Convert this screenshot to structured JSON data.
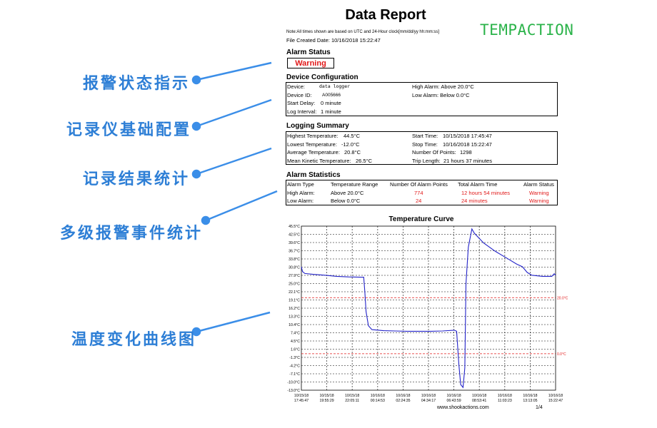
{
  "report": {
    "title": "Data Report",
    "brand": "TEMPACTION",
    "note": "Note:All times shown are based on UTC and 24-Hour clock[mm/dd/yy  hh:mm:ss]",
    "file_created": "File Created Date:  10/16/2018  15:22:47"
  },
  "alarm_status": {
    "heading": "Alarm Status",
    "value": "Warning"
  },
  "device_config": {
    "heading": "Device Configuration",
    "rows": [
      [
        "Device:",
        "data logger",
        "High Alarm: Above 20.0°C"
      ],
      [
        "Device ID:",
        "A005666",
        "Low Alarm:  Below 0.0°C"
      ],
      [
        "Start Delay:",
        "0 minute",
        ""
      ],
      [
        "Log Interval:",
        "1 minute",
        ""
      ]
    ]
  },
  "logging_summary": {
    "heading": "Logging Summary",
    "rows": [
      [
        "Highest Temperature:",
        "44.5°C",
        "Start Time:",
        "10/15/2018  17:45:47"
      ],
      [
        "Lowest Temperature:",
        "-12.0°C",
        "Stop Time:",
        "10/16/2018  15:22:47"
      ],
      [
        "Average Temperature:",
        "20.8°C",
        "Number Of Points:",
        "1298"
      ],
      [
        "Mean Kinetic Temperature:",
        "26.5°C",
        "Trip Length:",
        "21 hours 37 minutes"
      ]
    ]
  },
  "alarm_statistics": {
    "heading": "Alarm Statistics",
    "headers": [
      "Alarm Type",
      "Temperature Range",
      "Number Of Alarm Points",
      "Total Alarm Time",
      "Alarm Status"
    ],
    "rows": [
      [
        "High Alarm:",
        "Above  20.0°C",
        "774",
        "12 hours 54 minutes",
        "Warning"
      ],
      [
        "Low Alarm:",
        "Below  0.0°C",
        "24",
        "24 minutes",
        "Warning"
      ]
    ]
  },
  "callouts": [
    "报警状态指示",
    "记录仪基础配置",
    "记录结果统计",
    "多级报警事件统计",
    "温度变化曲线图"
  ],
  "colors": {
    "callout": "#2e7fd6",
    "arrow": "#3b8ee8",
    "brand": "#2bb34a",
    "alarm": "#e11818",
    "curve": "#2323c8"
  },
  "chart_data": {
    "type": "line",
    "title": "Temperature Curve",
    "y_ticks": [
      "45.5°C",
      "42.5°C",
      "39.6°C",
      "36.7°C",
      "33.8°C",
      "30.8°C",
      "27.9°C",
      "25.0°C",
      "22.1°C",
      "19.1°C",
      "16.2°C",
      "13.3°C",
      "10.4°C",
      "7.4°C",
      "4.5°C",
      "1.6°C",
      "-1.3°C",
      "-4.2°C",
      "-7.1°C",
      "-10.0°C",
      "-13.0°C"
    ],
    "ylim": [
      -13.0,
      45.5
    ],
    "x_ticks": [
      [
        "10/15/18",
        "17:45:47"
      ],
      [
        "10/15/18",
        "19:55:29"
      ],
      [
        "10/15/18",
        "22:05:11"
      ],
      [
        "10/16/18",
        "00:14:53"
      ],
      [
        "10/16/18",
        "02:24:35"
      ],
      [
        "10/16/18",
        "04:34:17"
      ],
      [
        "10/16/18",
        "06:43:59"
      ],
      [
        "10/16/18",
        "08:53:41"
      ],
      [
        "10/16/18",
        "11:03:23"
      ],
      [
        "10/16/18",
        "13:13:05"
      ],
      [
        "10/16/18",
        "15:22:47"
      ]
    ],
    "x_hours": [
      0,
      2.16,
      4.32,
      6.49,
      8.65,
      10.81,
      12.97,
      15.13,
      17.3,
      19.46,
      21.62
    ],
    "series": [
      {
        "values": [
          [
            0,
            31.0
          ],
          [
            0.1,
            29.3
          ],
          [
            0.3,
            28.6
          ],
          [
            1.0,
            28.3
          ],
          [
            2.0,
            28.0
          ],
          [
            3.0,
            27.6
          ],
          [
            4.0,
            27.4
          ],
          [
            5.0,
            27.3
          ],
          [
            5.3,
            27.3
          ],
          [
            5.4,
            22.0
          ],
          [
            5.5,
            15.0
          ],
          [
            5.7,
            10.0
          ],
          [
            6.0,
            8.6
          ],
          [
            7.0,
            8.2
          ],
          [
            8.0,
            8.1
          ],
          [
            9.0,
            8.0
          ],
          [
            10.0,
            8.0
          ],
          [
            11.0,
            8.0
          ],
          [
            12.0,
            8.1
          ],
          [
            13.0,
            8.4
          ],
          [
            13.2,
            8.0
          ],
          [
            13.4,
            -4.0
          ],
          [
            13.55,
            -11.0
          ],
          [
            13.75,
            -12.0
          ],
          [
            13.9,
            -5.0
          ],
          [
            14.0,
            25.0
          ],
          [
            14.2,
            38.0
          ],
          [
            14.5,
            44.5
          ],
          [
            14.7,
            43.0
          ],
          [
            15.5,
            39.5
          ],
          [
            16.5,
            36.5
          ],
          [
            17.5,
            34.0
          ],
          [
            18.3,
            32.0
          ],
          [
            18.8,
            31.0
          ],
          [
            19.2,
            29.0
          ],
          [
            19.6,
            28.0
          ],
          [
            20.5,
            27.6
          ],
          [
            21.3,
            27.6
          ],
          [
            21.5,
            28.5
          ],
          [
            21.62,
            28.0
          ]
        ]
      }
    ],
    "alarm_lines": [
      {
        "label": "20.0°C",
        "value": 20.0
      },
      {
        "label": "0.0°C",
        "value": 0.0
      }
    ]
  },
  "footer": {
    "website": "www.shookactions.com",
    "page": "1/4"
  }
}
